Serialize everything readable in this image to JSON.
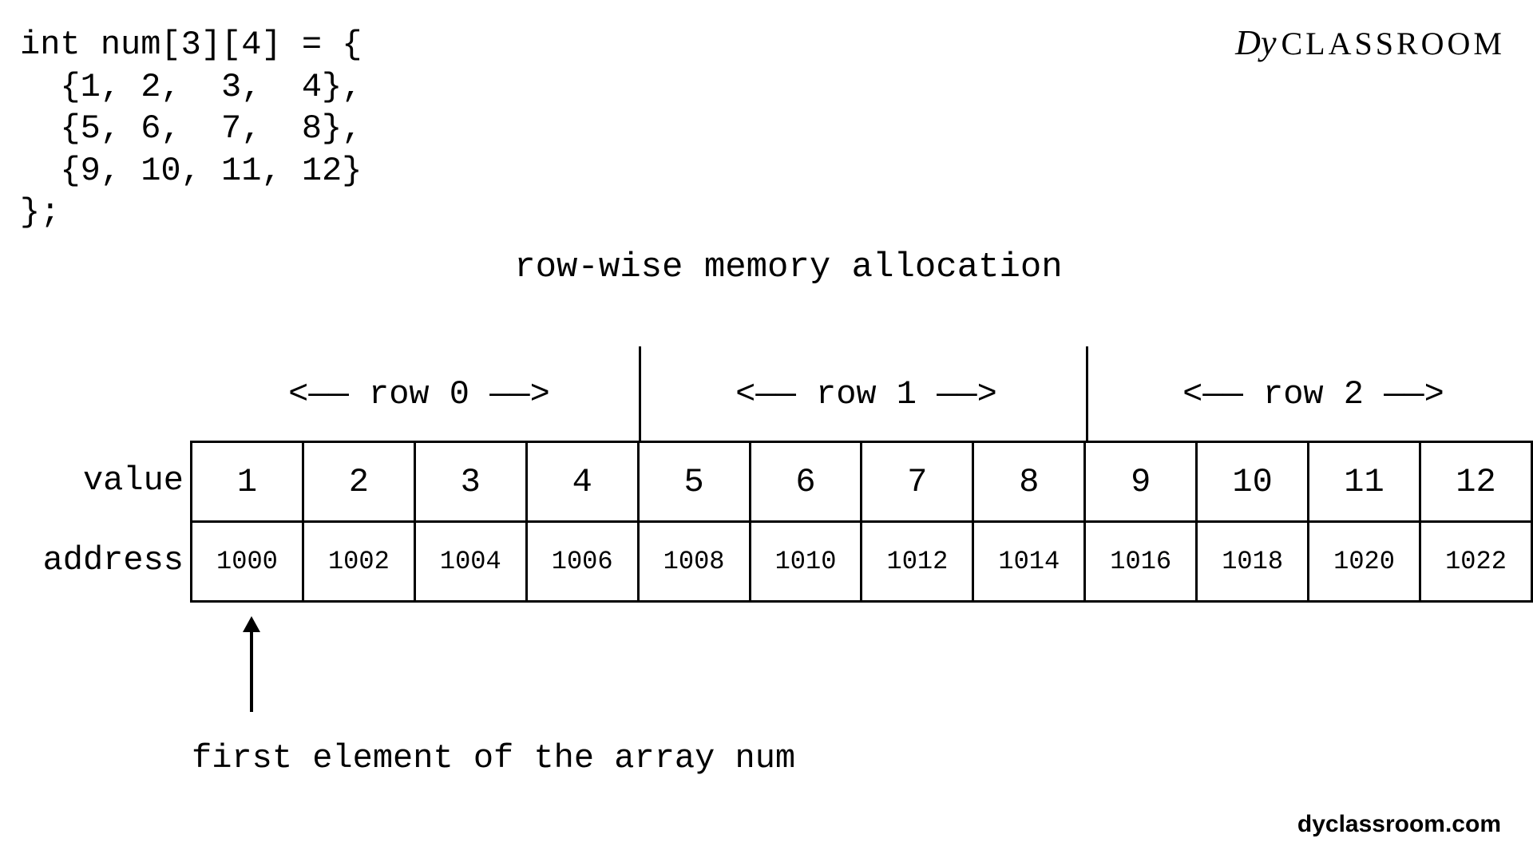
{
  "code": "int num[3][4] = {\n  {1, 2,  3,  4},\n  {5, 6,  7,  8},\n  {9, 10, 11, 12}\n};",
  "logo": {
    "prefix": "Dy",
    "text": "CLASSROOM"
  },
  "title": "row-wise memory allocation",
  "rows": {
    "r0": "<——  row 0  ——>",
    "r1": "<——  row 1  ——>",
    "r2": "<——  row 2  ——>"
  },
  "labels": {
    "value": "value",
    "address": "address"
  },
  "chart_data": {
    "type": "table",
    "title": "row-wise memory allocation",
    "columns": [
      "value",
      "address"
    ],
    "rows_groups": [
      "row 0",
      "row 0",
      "row 0",
      "row 0",
      "row 1",
      "row 1",
      "row 1",
      "row 1",
      "row 2",
      "row 2",
      "row 2",
      "row 2"
    ],
    "values": [
      "1",
      "2",
      "3",
      "4",
      "5",
      "6",
      "7",
      "8",
      "9",
      "10",
      "11",
      "12"
    ],
    "addresses": [
      "1000",
      "1002",
      "1004",
      "1006",
      "1008",
      "1010",
      "1012",
      "1014",
      "1016",
      "1018",
      "1020",
      "1022"
    ]
  },
  "caption": "first element of the array num",
  "footer": "dyclassroom.com"
}
